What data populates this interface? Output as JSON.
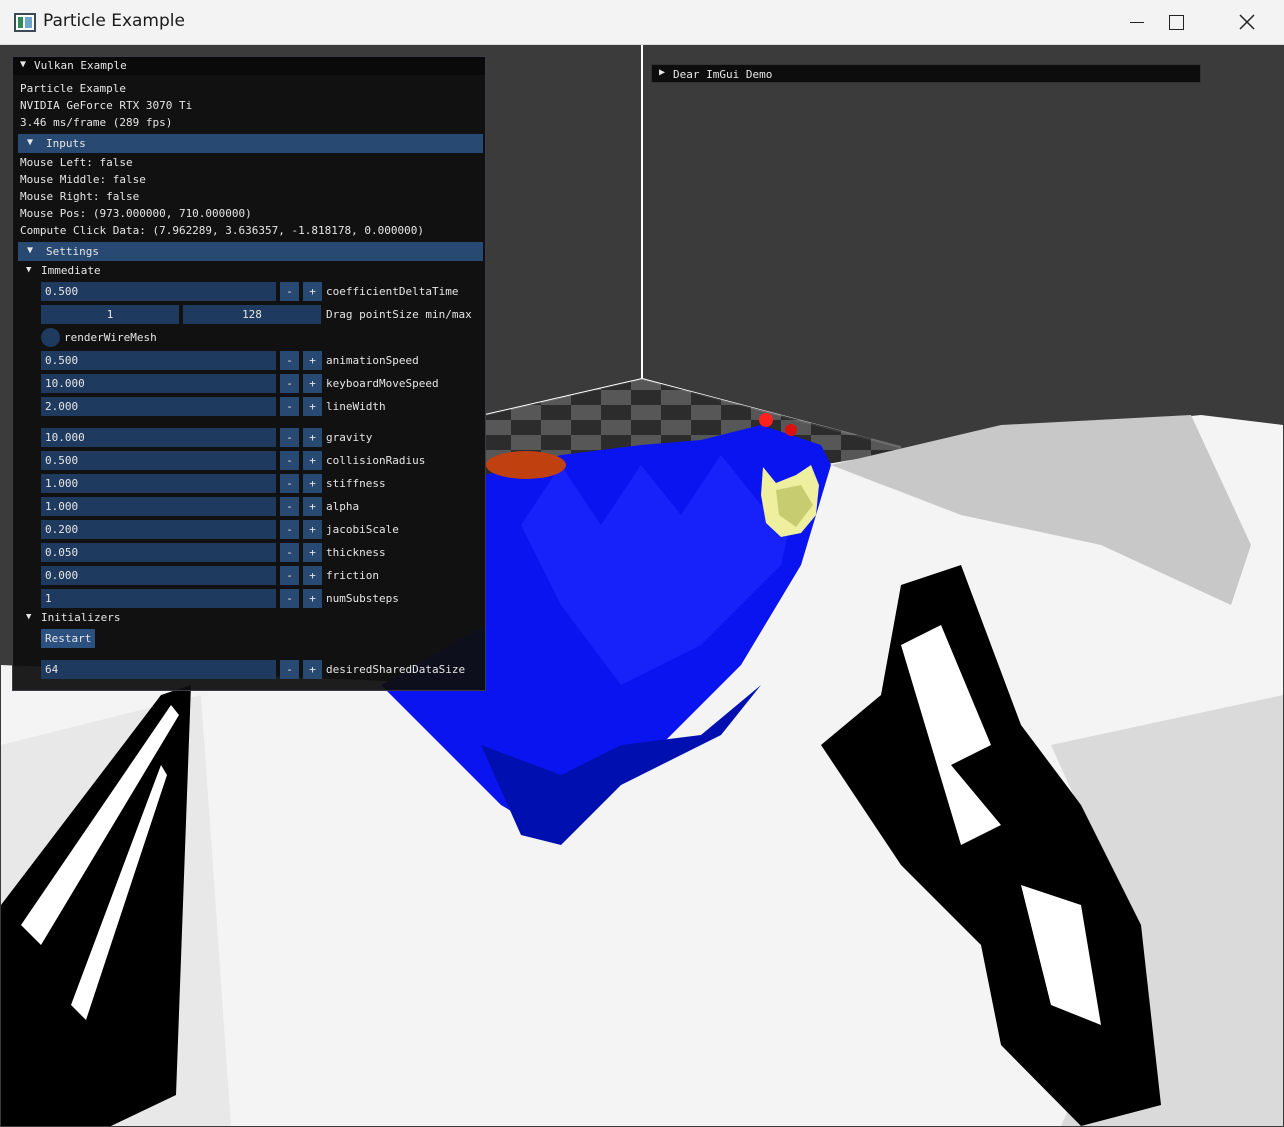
{
  "window": {
    "title": "Particle Example"
  },
  "colors": {
    "header": "#284a72",
    "field": "#1e3a5e",
    "mesh_blue": "#0a14f0"
  },
  "vulkan_window": {
    "title": "Vulkan Example",
    "app_name": "Particle Example",
    "gpu": "NVIDIA GeForce RTX 3070 Ti",
    "frame_time": "3.46 ms/frame (289 fps)"
  },
  "inputs": {
    "header": "Inputs",
    "mouse_left": "Mouse Left: false",
    "mouse_middle": "Mouse Middle: false",
    "mouse_right": "Mouse Right: false",
    "mouse_pos": "Mouse Pos: (973.000000, 710.000000)",
    "compute_click": "Compute Click Data: (7.962289, 3.636357, -1.818178, 0.000000)"
  },
  "settings": {
    "header": "Settings",
    "immediate": "Immediate",
    "coefficient_delta_time": {
      "value": "0.500",
      "label": "coefficientDeltaTime"
    },
    "point_size": {
      "min": "1",
      "max": "128",
      "label": "Drag pointSize min/max"
    },
    "render_wire_mesh": {
      "label": "renderWireMesh"
    },
    "animation_speed": {
      "value": "0.500",
      "label": "animationSpeed"
    },
    "keyboard_move_speed": {
      "value": "10.000",
      "label": "keyboardMoveSpeed"
    },
    "line_width": {
      "value": "2.000",
      "label": "lineWidth"
    },
    "gravity": {
      "value": "10.000",
      "label": "gravity"
    },
    "collision_radius": {
      "value": "0.500",
      "label": "collisionRadius"
    },
    "stiffness": {
      "value": "1.000",
      "label": "stiffness"
    },
    "alpha": {
      "value": "1.000",
      "label": "alpha"
    },
    "jacobi_scale": {
      "value": "0.200",
      "label": "jacobiScale"
    },
    "thickness": {
      "value": "0.050",
      "label": "thickness"
    },
    "friction": {
      "value": "0.000",
      "label": "friction"
    },
    "num_substeps": {
      "value": "1",
      "label": "numSubsteps"
    },
    "initializers": "Initializers",
    "restart": "Restart",
    "desired_shared_data_size": {
      "value": "64",
      "label": "desiredSharedDataSize"
    }
  },
  "stepper": {
    "minus": "-",
    "plus": "+"
  },
  "demo_window": {
    "title": "Dear ImGui Demo"
  }
}
